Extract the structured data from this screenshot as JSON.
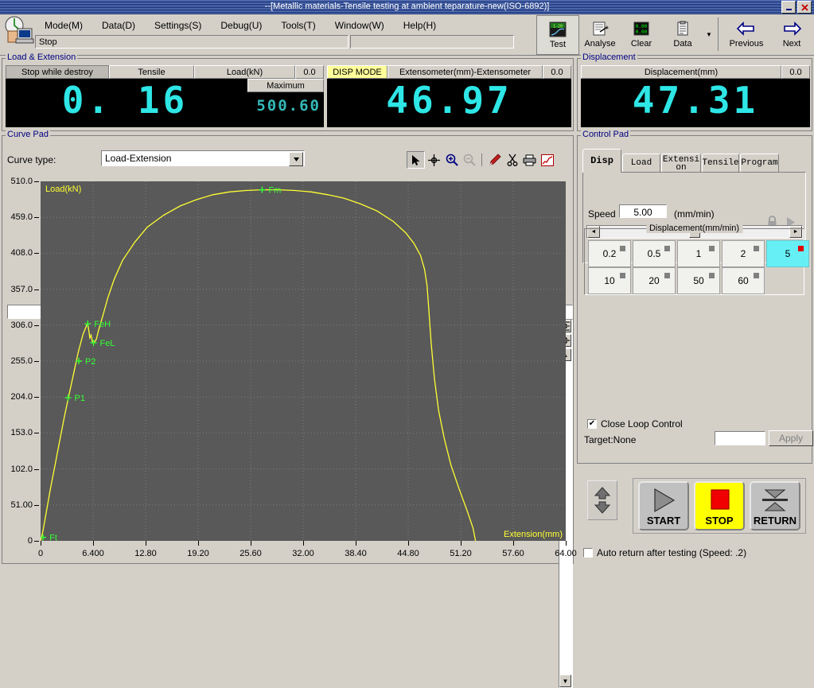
{
  "window": {
    "title": "--[Metallic materials-Tensile testing at ambient teparature-new(ISO-6892)]",
    "minimize_label": "_",
    "close_label": "X"
  },
  "menu": {
    "items": [
      {
        "text": "Mode(M)",
        "label": "Mode",
        "key": "M"
      },
      {
        "text": "Data(D)",
        "label": "Data",
        "key": "D"
      },
      {
        "text": "Settings(S)",
        "label": "Settings",
        "key": "S"
      },
      {
        "text": "Debug(U)",
        "label": "Debug",
        "key": "U"
      },
      {
        "text": "Tools(T)",
        "label": "Tools",
        "key": "T"
      },
      {
        "text": "Window(W)",
        "label": "Window",
        "key": "W"
      },
      {
        "text": "Help(H)",
        "label": "Help",
        "key": "H"
      }
    ]
  },
  "status": {
    "text": "Stop",
    "second": ""
  },
  "toolbar": {
    "items": [
      {
        "label": "Test",
        "icon": "chart-test-icon"
      },
      {
        "label": "Analyse",
        "icon": "analyse-icon"
      },
      {
        "label": "Clear",
        "icon": "clear-digits-icon"
      },
      {
        "label": "Data",
        "icon": "clipboard-icon"
      }
    ],
    "dropdown": "▼",
    "previous": "Previous",
    "next": "Next"
  },
  "load_extension": {
    "title": "Load & Extension",
    "stop_while_destroy": "Stop while destroy",
    "tensile": "Tensile",
    "load_unit": "Load(kN)",
    "load_zero": "0.0",
    "load_value": "0. 16",
    "maximum_label": "Maximum",
    "maximum_value": "500.60",
    "disp_mode": "DISP MODE",
    "extensometer_label": "Extensometer(mm)-Extensometer",
    "extensometer_zero": "0.0",
    "extensometer_value": "46.97"
  },
  "displacement": {
    "title": "Displacement",
    "label": "Displacement(mm)",
    "zero": "0.0",
    "value": "47.31"
  },
  "curve_pad": {
    "title": "Curve Pad",
    "curve_type_label": "Curve type:",
    "curve_type_value": "Load-Extension",
    "tools": [
      {
        "name": "select-arrow-icon",
        "state": "pressed"
      },
      {
        "name": "crosshair-icon",
        "state": "normal"
      },
      {
        "name": "zoom-in-icon",
        "state": "normal"
      },
      {
        "name": "zoom-out-icon",
        "state": "disabled"
      },
      {
        "name": "marker-pen-icon",
        "state": "normal"
      },
      {
        "name": "scissors-icon",
        "state": "normal"
      },
      {
        "name": "print-icon",
        "state": "normal"
      },
      {
        "name": "curve-icon",
        "state": "normal"
      }
    ],
    "scroll_left": "◄",
    "scroll_right": "►",
    "fit_width": "╦",
    "fit_all": "↔",
    "v_up": "▲",
    "v_down": "▼"
  },
  "chart_data": {
    "type": "line",
    "title": "",
    "xlabel": "Extension(mm)",
    "ylabel": "Load(kN)",
    "xlim": [
      0,
      64.0
    ],
    "ylim": [
      0,
      510.0
    ],
    "xticks": [
      "0",
      "6.400",
      "12.80",
      "19.20",
      "25.60",
      "32.00",
      "38.40",
      "44.80",
      "51.20",
      "57.60",
      "64.00"
    ],
    "xtick_values": [
      0,
      6.4,
      12.8,
      19.2,
      25.6,
      32.0,
      38.4,
      44.8,
      51.2,
      57.6,
      64.0
    ],
    "yticks": [
      "0",
      "51.00",
      "102.0",
      "153.0",
      "204.0",
      "255.0",
      "306.0",
      "357.0",
      "408.0",
      "459.0",
      "510.0"
    ],
    "ytick_values": [
      0,
      51,
      102,
      153,
      204,
      255,
      306,
      357,
      408,
      459,
      510
    ],
    "grid": true,
    "legend": "none",
    "series": [
      {
        "name": "Load-Extension",
        "color": "#ffff33",
        "points": [
          [
            0.0,
            0
          ],
          [
            0.25,
            12
          ],
          [
            0.5,
            28
          ],
          [
            0.8,
            48
          ],
          [
            1.2,
            74
          ],
          [
            1.8,
            110
          ],
          [
            2.3,
            140
          ],
          [
            2.9,
            176
          ],
          [
            3.4,
            204
          ],
          [
            4.0,
            236
          ],
          [
            4.6,
            268
          ],
          [
            5.2,
            294
          ],
          [
            5.6,
            305
          ],
          [
            5.75,
            308
          ],
          [
            5.9,
            297
          ],
          [
            6.0,
            288
          ],
          [
            6.15,
            292
          ],
          [
            6.3,
            283
          ],
          [
            6.5,
            281
          ],
          [
            6.8,
            286
          ],
          [
            7.1,
            300
          ],
          [
            7.6,
            320
          ],
          [
            8.2,
            345
          ],
          [
            9.0,
            372
          ],
          [
            10.0,
            398
          ],
          [
            11.5,
            424
          ],
          [
            13.0,
            445
          ],
          [
            15.0,
            462
          ],
          [
            17.0,
            475
          ],
          [
            19.0,
            484
          ],
          [
            21.0,
            491
          ],
          [
            23.0,
            495
          ],
          [
            25.0,
            497
          ],
          [
            27.0,
            498
          ],
          [
            29.0,
            498
          ],
          [
            31.0,
            497
          ],
          [
            33.0,
            495
          ],
          [
            35.0,
            491
          ],
          [
            37.0,
            486
          ],
          [
            39.0,
            478
          ],
          [
            41.0,
            468
          ],
          [
            43.0,
            453
          ],
          [
            44.5,
            437
          ],
          [
            45.5,
            422
          ],
          [
            46.3,
            405
          ],
          [
            46.8,
            385
          ],
          [
            47.1,
            362
          ],
          [
            47.3,
            330
          ],
          [
            47.6,
            280
          ],
          [
            48.0,
            230
          ],
          [
            48.5,
            185
          ],
          [
            49.2,
            145
          ],
          [
            50.0,
            108
          ],
          [
            51.0,
            74
          ],
          [
            52.0,
            42
          ],
          [
            52.7,
            18
          ],
          [
            53.0,
            0
          ]
        ]
      }
    ],
    "markers": [
      {
        "label": "Ft",
        "x": 0.3,
        "y": 5,
        "color": "#33ff33"
      },
      {
        "label": "P1",
        "x": 3.35,
        "y": 203,
        "color": "#33ff33"
      },
      {
        "label": "P2",
        "x": 4.65,
        "y": 255,
        "color": "#33ff33"
      },
      {
        "label": "FeH",
        "x": 5.75,
        "y": 308,
        "color": "#33ff33"
      },
      {
        "label": "FeL",
        "x": 6.45,
        "y": 281,
        "color": "#33ff33"
      },
      {
        "label": "Fm",
        "x": 27.0,
        "y": 498,
        "color": "#33ff33"
      }
    ]
  },
  "control_pad": {
    "title": "Control Pad",
    "tabs": [
      {
        "label": "Disp",
        "active": true
      },
      {
        "label": "Load",
        "active": false
      },
      {
        "label": "Extension",
        "line1": "Extensi",
        "line2": "on",
        "active": false
      },
      {
        "label": "Tensile",
        "active": false
      },
      {
        "label": "Program",
        "active": false
      }
    ],
    "lock_icon": "padlock-icon",
    "play_icon": "play-arrow-icon",
    "speed_label": "Speed",
    "speed_value": "5.00",
    "speed_unit": "(mm/min)",
    "slider_left": "◄",
    "slider_right": "►",
    "fieldset_legend": "Displacement(mm/min)",
    "speed_buttons": [
      {
        "label": "0.2",
        "selected": false
      },
      {
        "label": "0.5",
        "selected": false
      },
      {
        "label": "1",
        "selected": false
      },
      {
        "label": "2",
        "selected": false
      },
      {
        "label": "5",
        "selected": true
      },
      {
        "label": "10",
        "selected": false
      },
      {
        "label": "20",
        "selected": false
      },
      {
        "label": "50",
        "selected": false
      },
      {
        "label": "60",
        "selected": false
      }
    ],
    "close_loop_label": "Close Loop Control",
    "close_loop_checked": "✔",
    "target_label": "Target:None",
    "target_value": "",
    "apply_label": "Apply",
    "start_label": "START",
    "stop_label": "STOP",
    "return_label": "RETURN",
    "auto_return_label": "Auto return after testing (Speed: .2)",
    "auto_return_checked": ""
  }
}
